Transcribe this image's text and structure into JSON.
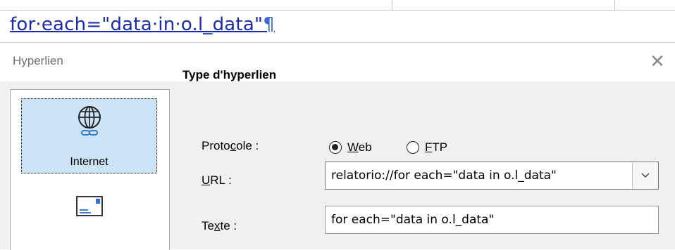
{
  "document": {
    "line_text": "for·each=\"data·in·o.l_data\"",
    "pilcrow": "¶"
  },
  "dialog": {
    "title": "Hyperlien",
    "close_symbol": "✕",
    "sidebar": {
      "items": [
        {
          "label": "Internet",
          "icon": "globe-link-icon",
          "selected": true
        },
        {
          "label": "",
          "icon": "mail-icon",
          "selected": false
        }
      ]
    },
    "section_title": "Type d'hyperlien",
    "protocol": {
      "label_pre": "Proto",
      "label_acc": "c",
      "label_post": "ole :",
      "options": [
        {
          "acc": "W",
          "rest": "eb",
          "selected": true
        },
        {
          "acc": "F",
          "rest": "TP",
          "selected": false
        }
      ]
    },
    "url": {
      "label_acc": "U",
      "label_post": "RL :",
      "value": "relatorio://for each=\"data in o.l_data\""
    },
    "text": {
      "label_pre": "Te",
      "label_acc": "x",
      "label_post": "te :",
      "value": "for each=\"data in o.l_data\""
    }
  }
}
